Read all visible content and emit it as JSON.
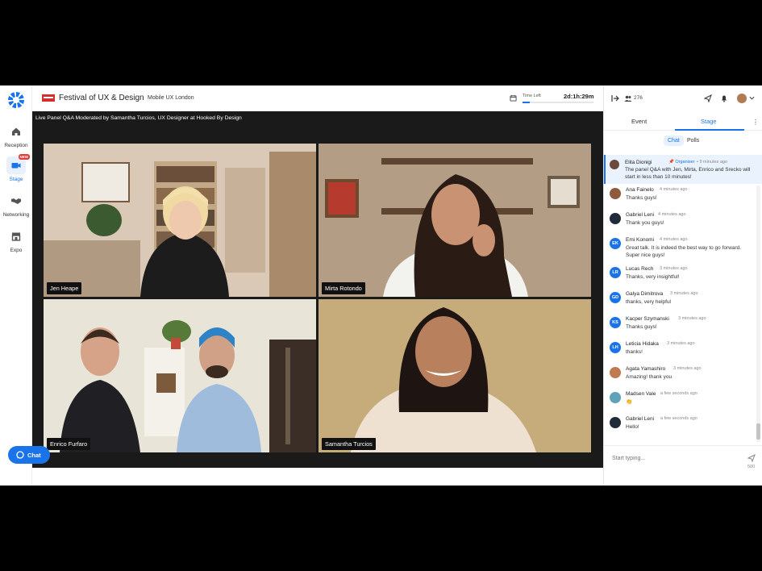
{
  "nav": {
    "items": [
      {
        "label": "Reception",
        "icon": "home-icon"
      },
      {
        "label": "Stage",
        "icon": "camera-icon",
        "badge": "NEW"
      },
      {
        "label": "Networking",
        "icon": "handshake-icon"
      },
      {
        "label": "Expo",
        "icon": "store-icon"
      }
    ]
  },
  "header": {
    "title": "Festival of UX & Design",
    "subtitle": "Mobile UX London",
    "time_left_label": "Time Left",
    "time_left_value": "2d:1h:29m",
    "time_progress": 0.1
  },
  "stage": {
    "heading": "Live Panel Q&A Moderated by Samantha Turcios, UX Designer at Hooked By Design",
    "participants": [
      {
        "name": "Jen Heape"
      },
      {
        "name": "Mirta Rotondo"
      },
      {
        "name": "Enrico Furfaro"
      },
      {
        "name": "Samantha Turcios"
      }
    ]
  },
  "chat_button": {
    "label": "Chat"
  },
  "panel": {
    "attendee_count": "276",
    "tabs": [
      "Event",
      "Stage"
    ],
    "active_tab": "Stage",
    "subtabs": [
      "Chat",
      "Polls"
    ],
    "active_subtab": "Chat",
    "pinned": {
      "name": "Elita Dionigi",
      "role": "Organiser",
      "time": "• 9 minutes ago",
      "text": "The panel Q&A with Jen, Mirta, Enrico and Srecko will start in less than 10 minutes!"
    },
    "messages": [
      {
        "name": "Ana Fainelo",
        "time": "4 minutes ago",
        "text": "Thanks guys!",
        "initials": "",
        "color": "#8d5a3f"
      },
      {
        "name": "Gabriel Leni",
        "time": "4 minutes ago",
        "text": "Thank you guys!",
        "initials": "",
        "color": "#1f2a3a"
      },
      {
        "name": "Emi Konomi",
        "time": "4 minutes ago",
        "text": "Great talk. It is indeed the best way to go forward. Super nice guys!",
        "initials": "EK",
        "color": "#1a73e8"
      },
      {
        "name": "Lucas Rech",
        "time": "3 minutes ago",
        "text": "Thanks, very insightful!",
        "initials": "LR",
        "color": "#1a73e8"
      },
      {
        "name": "Galya Dimitrova",
        "time": "3 minutes ago",
        "text": "thanks, very helpful",
        "initials": "GD",
        "color": "#1a73e8"
      },
      {
        "name": "Kacper Szymanski",
        "time": "3 minutes ago",
        "text": "Thanks guys!",
        "initials": "KS",
        "color": "#1a73e8"
      },
      {
        "name": "Leticia Hidaka",
        "time": "3 minutes ago",
        "text": "thanks!",
        "initials": "LH",
        "color": "#1a73e8"
      },
      {
        "name": "Agata Yamashiro",
        "time": "3 minutes ago",
        "text": "Amazing! thank you",
        "initials": "",
        "color": "#c07a4f"
      },
      {
        "name": "Madsen Vale",
        "time": "a few seconds ago",
        "text": "👏",
        "initials": "",
        "color": "#5fa3b8"
      },
      {
        "name": "Gabriel Leni",
        "time": "a few seconds ago",
        "text": "Hello!",
        "initials": "",
        "color": "#1f2a3a"
      }
    ],
    "input_placeholder": "Start typing...",
    "char_count": "500"
  }
}
